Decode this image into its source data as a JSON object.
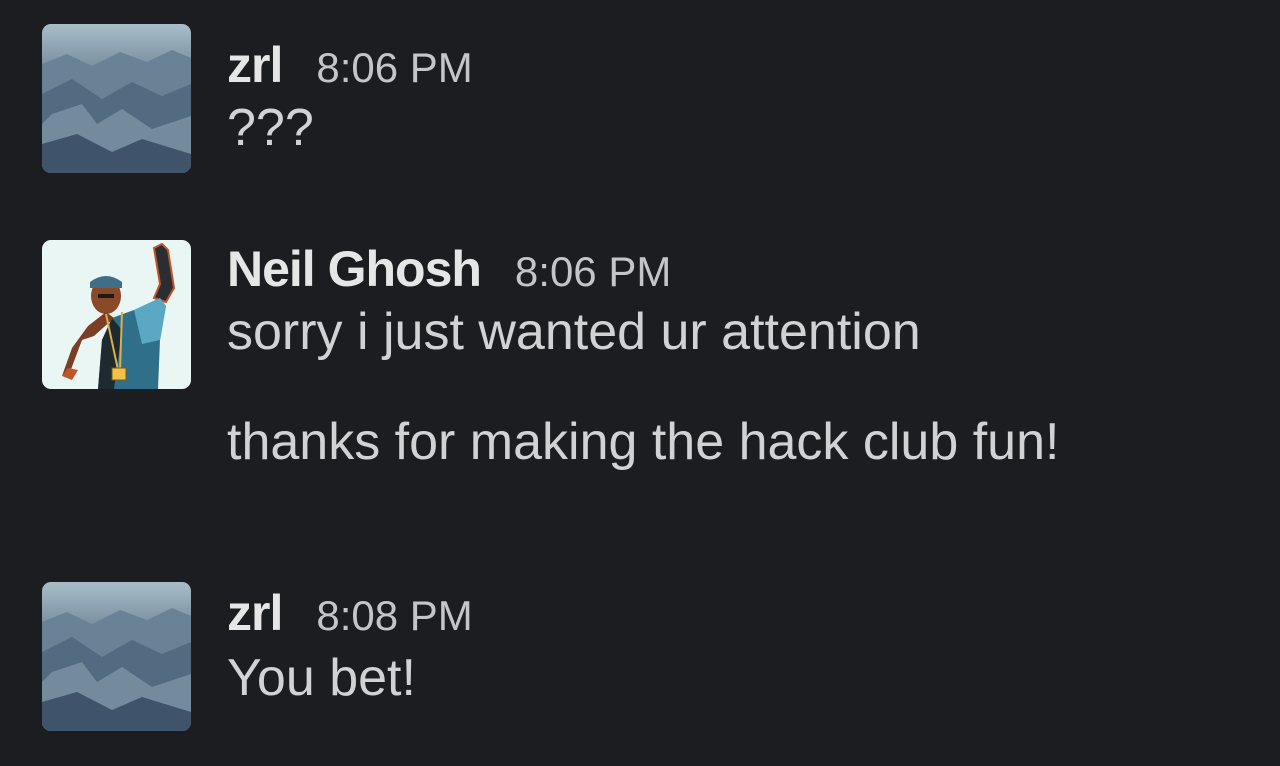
{
  "messages": [
    {
      "sender": "zrl",
      "time": "8:06 PM",
      "avatar": "mountain-avatar",
      "lines": [
        "???"
      ]
    },
    {
      "sender": "Neil Ghosh",
      "time": "8:06 PM",
      "avatar": "person-illustration-avatar",
      "lines": [
        "sorry i just wanted ur attention",
        "thanks for making the hack club fun!"
      ]
    },
    {
      "sender": "zrl",
      "time": "8:08 PM",
      "avatar": "mountain-avatar",
      "lines": [
        "You bet!"
      ]
    }
  ],
  "colors": {
    "background": "#1b1d21",
    "sender_text": "#e6e6e6",
    "message_text": "#d1d2d3",
    "timestamp_text": "#c4c5c7"
  }
}
